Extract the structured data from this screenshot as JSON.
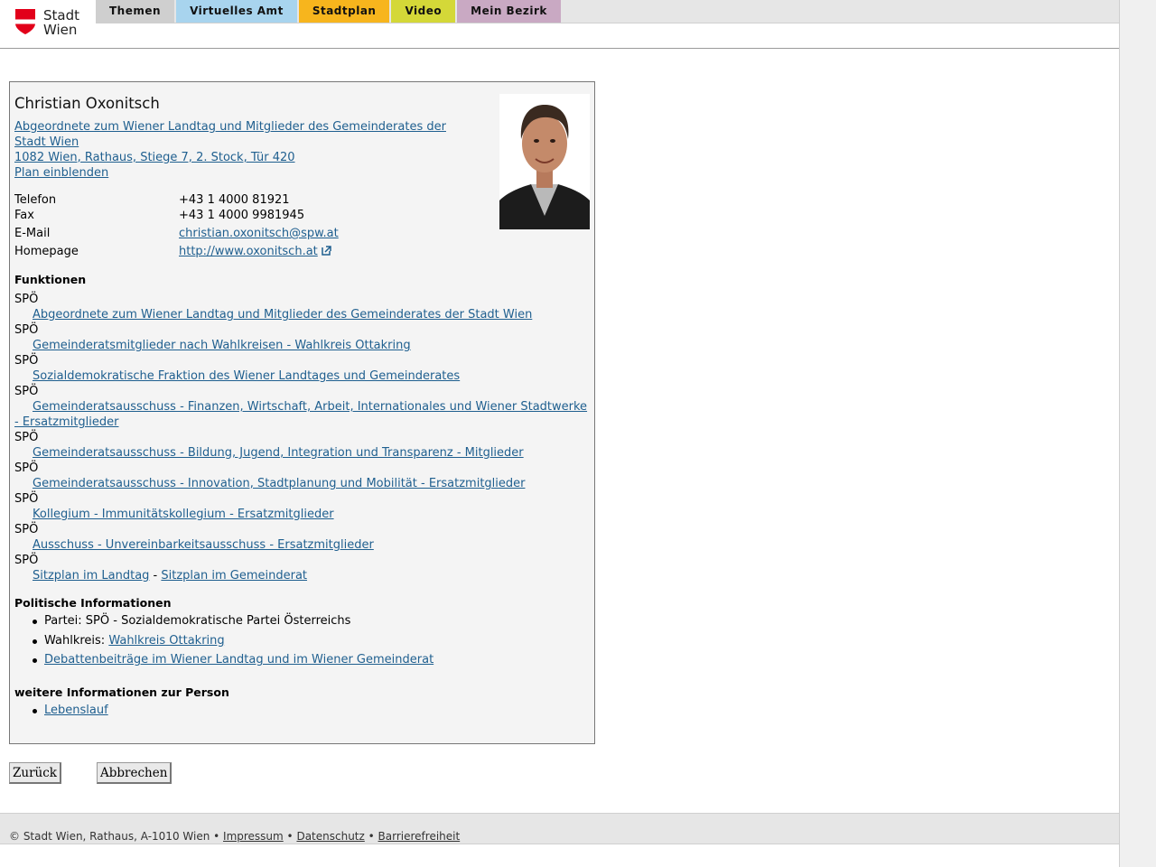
{
  "header": {
    "logo": {
      "line1": "Stadt",
      "line2": "Wien"
    },
    "tabs": [
      {
        "label": "Themen",
        "color": "#cfcfcf"
      },
      {
        "label": "Virtuelles Amt",
        "color": "#a8d4ee"
      },
      {
        "label": "Stadtplan",
        "color": "#f7b51d"
      },
      {
        "label": "Video",
        "color": "#d4d838"
      },
      {
        "label": "Mein Bezirk",
        "color": "#c9a9c3"
      }
    ]
  },
  "person": {
    "name": "Christian Oxonitsch",
    "affiliation_line1": "Abgeordnete zum Wiener Landtag und Mitglieder des Gemeinderates der",
    "affiliation_line2": "Stadt Wien ",
    "address": "1082 Wien, Rathaus, Stiege 7, 2. Stock, Tür 420",
    "plan_link": "Plan einblenden",
    "contact": {
      "phone_label": "Telefon",
      "phone": "+43 1 4000 81921",
      "fax_label": "Fax",
      "fax": "+43 1 4000 9981945",
      "email_label": "E-Mail",
      "email": "christian.oxonitsch@spw.at",
      "homepage_label": "Homepage",
      "homepage": "http://www.oxonitsch.at"
    }
  },
  "functions": {
    "heading": "Funktionen",
    "items": [
      {
        "org": "SPÖ",
        "role": "Abgeordnete zum Wiener Landtag und Mitglieder des Gemeinderates der Stadt Wien"
      },
      {
        "org": "SPÖ",
        "role": "Gemeinderatsmitglieder nach Wahlkreisen - Wahlkreis Ottakring"
      },
      {
        "org": "SPÖ",
        "role": "Sozialdemokratische Fraktion des Wiener Landtages und Gemeinderates"
      },
      {
        "org": "SPÖ",
        "role": "Gemeinderatsausschuss - Finanzen, Wirtschaft, Arbeit, Internationales und Wiener Stadtwerke - Ersatzmitglieder"
      },
      {
        "org": "SPÖ",
        "role": "Gemeinderatsausschuss - Bildung, Jugend, Integration und Transparenz - Mitglieder"
      },
      {
        "org": "SPÖ",
        "role": "Gemeinderatsausschuss - Innovation, Stadtplanung und Mobilität - Ersatzmitglieder"
      },
      {
        "org": "SPÖ",
        "role": "Kollegium - Immunitätskollegium - Ersatzmitglieder"
      },
      {
        "org": "SPÖ",
        "role": "Ausschuss - Unvereinbarkeitsausschuss - Ersatzmitglieder"
      }
    ],
    "last_org": "SPÖ",
    "seat_landtag": "Sitzplan im Landtag",
    "seat_sep": " - ",
    "seat_gemeinderat": "Sitzplan im Gemeinderat"
  },
  "political": {
    "heading": "Politische Informationen",
    "party": "Partei: SPÖ - Sozialdemokratische Partei Österreichs",
    "district_prefix": "Wahlkreis: ",
    "district": "Wahlkreis Ottakring",
    "debates": "Debattenbeiträge im Wiener Landtag und im Wiener Gemeinderat"
  },
  "more": {
    "heading": "weitere Informationen zur Person",
    "cv": "Lebenslauf"
  },
  "buttons": {
    "back": "Zurück",
    "cancel": "Abbrechen"
  },
  "footer": {
    "copyright": "© Stadt Wien, Rathaus, A-1010 Wien",
    "sep": " • ",
    "imprint": "Impressum",
    "privacy": "Datenschutz",
    "accessibility": "Barrierefreiheit"
  },
  "colors": {
    "link": "#1f5f8f",
    "logo_red": "#e2001a"
  }
}
